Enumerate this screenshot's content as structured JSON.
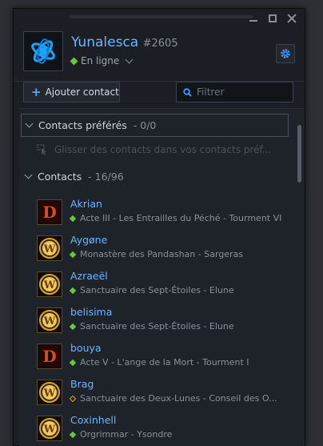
{
  "profile": {
    "name": "Yunalesca",
    "tag": "#2605",
    "status": "En ligne"
  },
  "toolbar": {
    "add_contact_label": "Ajouter contact",
    "filter_placeholder": "Filtrer"
  },
  "favorites": {
    "title": "Contacts préférés",
    "count": "- 0/0",
    "hint": "Glisser des contacts dans vos contacts préf..."
  },
  "contacts": {
    "title": "Contacts",
    "count": "- 16/96",
    "items": [
      {
        "name": "Akrian",
        "game": "diablo-icon",
        "status_type": "online",
        "activity": "Acte III - Les Entrailles du Péché - Tourment VI"
      },
      {
        "name": "Aygøne",
        "game": "wow-icon",
        "status_type": "online",
        "activity": "Monastère des Pandashan - Sargeras"
      },
      {
        "name": "Azraeël",
        "game": "wow-icon",
        "status_type": "online",
        "activity": "Sanctuaire des Sept-Étoiles - Elune"
      },
      {
        "name": "belisima",
        "game": "wow-icon",
        "status_type": "online",
        "activity": "Sanctuaire des Sept-Étoiles - Elune"
      },
      {
        "name": "bouya",
        "game": "diablo-icon",
        "status_type": "online",
        "activity": "Acte V - L'ange de la Mort - Tourment I"
      },
      {
        "name": "Brag",
        "game": "wow-icon",
        "status_type": "away",
        "activity": "Sanctuaire des Deux-Lunes - Conseil des O..."
      },
      {
        "name": "Coxinhell",
        "game": "wow-icon",
        "status_type": "online",
        "activity": "Orgrimmar - Ysondre"
      }
    ]
  },
  "colors": {
    "accent_blue": "#6fb5ff",
    "online_green": "#6cc43a",
    "away_yellow": "#d9a420"
  }
}
